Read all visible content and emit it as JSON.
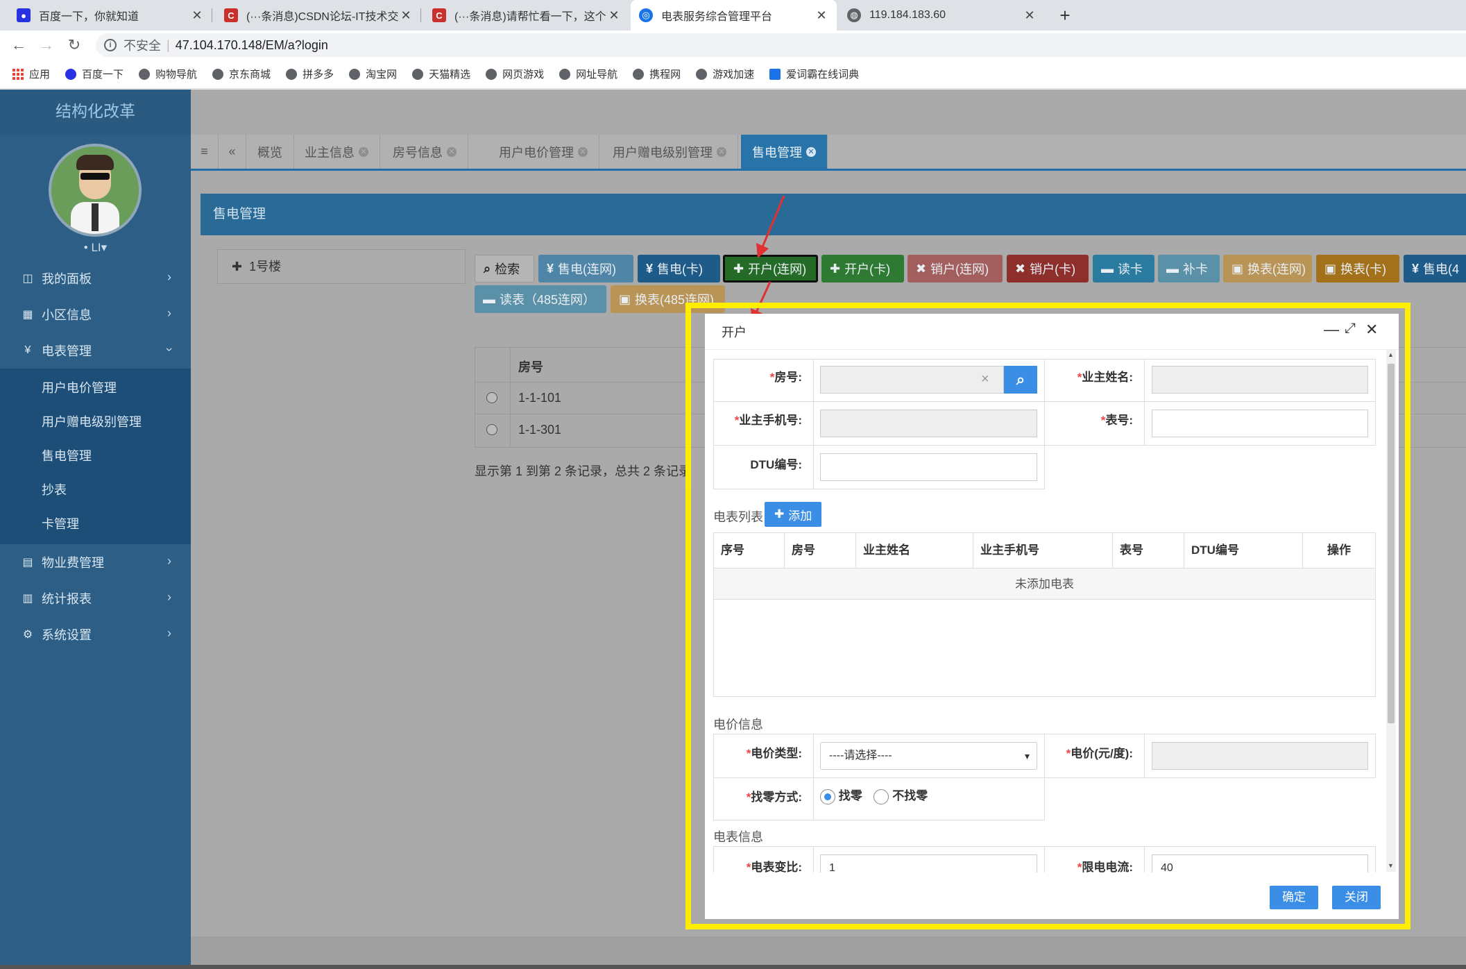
{
  "browser": {
    "tabs": [
      {
        "title": "百度一下，你就知道"
      },
      {
        "title": "(···条消息)CSDN论坛-IT技术交流"
      },
      {
        "title": "(···条消息)请帮忙看一下，这个窗口"
      },
      {
        "title": "电表服务综合管理平台"
      },
      {
        "title": "119.184.183.60"
      }
    ],
    "new_tab": "+",
    "insecure_label": "不安全",
    "url": "47.104.170.148/EM/a?login",
    "bookmarks": [
      "应用",
      "百度一下",
      "购物导航",
      "京东商城",
      "拼多多",
      "淘宝网",
      "天猫精选",
      "网页游戏",
      "网址导航",
      "携程网",
      "游戏加速",
      "爱词霸在线词典"
    ]
  },
  "sidebar": {
    "brand": "结构化改革",
    "user": "• LI▾",
    "menu": [
      {
        "label": "我的面板",
        "icon": "columns-icon"
      },
      {
        "label": "小区信息",
        "icon": "grid-icon"
      },
      {
        "label": "电表管理",
        "icon": "yen-icon"
      }
    ],
    "submenu": [
      "用户电价管理",
      "用户赠电级别管理",
      "售电管理",
      "抄表",
      "卡管理"
    ],
    "menu_after": [
      {
        "label": "物业费管理",
        "icon": "book-icon"
      },
      {
        "label": "统计报表",
        "icon": "bar-chart-icon"
      },
      {
        "label": "系统设置",
        "icon": "gear-icon"
      }
    ]
  },
  "page_tabs": [
    "概览",
    "业主信息",
    "房号信息",
    "用户电价管理",
    "用户赠电级别管理",
    "售电管理"
  ],
  "panel": {
    "title": "售电管理",
    "tree_node": "1号楼",
    "buttons": [
      "检索",
      "售电(连网)",
      "售电(卡)",
      "开户(连网)",
      "开户(卡)",
      "销户(连网)",
      "销户(卡)",
      "读卡",
      "补卡",
      "换表(连网)",
      "换表(卡)",
      "售电(4"
    ],
    "buttons_row2": [
      "读表（485连网）",
      "换表(485连网)"
    ],
    "table_header": "房号",
    "rows": [
      "1-1-101",
      "1-1-301"
    ],
    "page_info": "显示第 1 到第 2 条记录，总共 2 条记录"
  },
  "dialog": {
    "title": "开户",
    "labels": {
      "room": "房号:",
      "owner": "业主姓名:",
      "phone": "业主手机号:",
      "meter": "表号:",
      "dtu": "DTU编号:",
      "price_type": "电价类型:",
      "price": "电价(元/度):",
      "change": "找零方式:",
      "ratio": "电表变比:",
      "limit": "限电电流:"
    },
    "clear_x": "×",
    "meter_list_title": "电表列表",
    "add_label": "添加",
    "meter_table_headers": [
      "序号",
      "房号",
      "业主姓名",
      "业主手机号",
      "表号",
      "DTU编号",
      "操作"
    ],
    "meter_table_empty": "未添加电表",
    "price_section": "电价信息",
    "price_type_placeholder": "----请选择----",
    "change_option_1": "找零",
    "change_option_2": "不找零",
    "meter_section": "电表信息",
    "ratio_value": "1",
    "limit_value": "40",
    "confirm_label": "确定",
    "close_label": "关闭"
  },
  "colors": {
    "sidebar": "#2d5f86",
    "highlight": "#ffee00",
    "primary": "#3a8ee6"
  }
}
